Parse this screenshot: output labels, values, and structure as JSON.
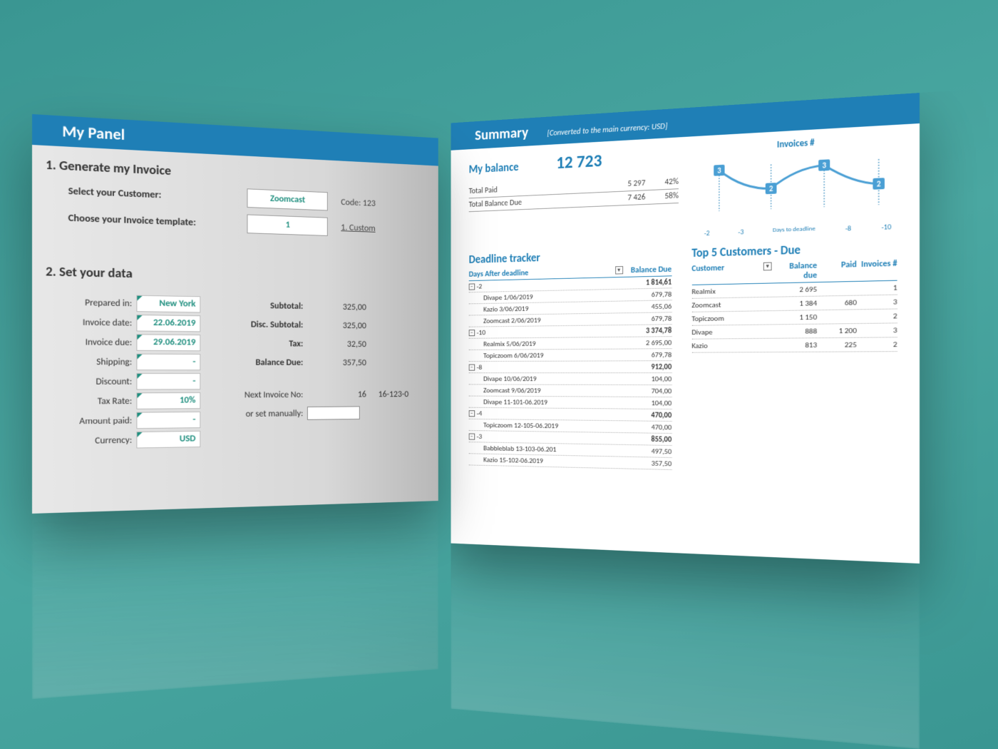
{
  "left_panel": {
    "title": "My Panel",
    "section1": {
      "title": "1. Generate my Invoice",
      "customer_label": "Select your Customer:",
      "customer_value": "Zoomcast",
      "customer_code": "Code: 123",
      "template_label": "Choose your Invoice template:",
      "template_value": "1",
      "template_name": "1. Custom"
    },
    "section2": {
      "title": "2. Set your data",
      "prepared_in_label": "Prepared in:",
      "prepared_in": "New York",
      "invoice_date_label": "Invoice date:",
      "invoice_date": "22.06.2019",
      "invoice_due_label": "Invoice due:",
      "invoice_due": "29.06.2019",
      "shipping_label": "Shipping:",
      "shipping": "-",
      "discount_label": "Discount:",
      "discount": "-",
      "tax_rate_label": "Tax Rate:",
      "tax_rate": "10%",
      "amount_paid_label": "Amount paid:",
      "amount_paid": "-",
      "currency_label": "Currency:",
      "currency": "USD",
      "subtotal_label": "Subtotal:",
      "subtotal": "325,00",
      "disc_subtotal_label": "Disc. Subtotal:",
      "disc_subtotal": "325,00",
      "tax_label": "Tax:",
      "tax": "32,50",
      "balance_due_label": "Balance Due:",
      "balance_due": "357,50",
      "next_invoice_label": "Next Invoice No:",
      "next_invoice_no": "16",
      "next_invoice_full": "16-123-0",
      "manual_label": "or set manually:"
    }
  },
  "right_panel": {
    "title": "Summary",
    "subtitle": "[Converted to the main currency: USD]",
    "balance_title": "My balance",
    "balance_value": "12 723",
    "totals": [
      {
        "label": "Total Paid",
        "amount": "5 297",
        "pct": "42%"
      },
      {
        "label": "Total Balance Due",
        "amount": "7 426",
        "pct": "58%"
      }
    ],
    "tracker_title": "Deadline tracker",
    "tracker_head_days": "Days After deadline",
    "tracker_head_bal": "Balance Due",
    "tracker_groups": [
      {
        "group": "-2",
        "total": "1 814,61",
        "rows": [
          {
            "name": "Divape 1/06/2019",
            "val": "679,78"
          },
          {
            "name": "Kazio 3/06/2019",
            "val": "455,06"
          },
          {
            "name": "Zoomcast 2/06/2019",
            "val": "679,78"
          }
        ]
      },
      {
        "group": "-10",
        "total": "3 374,78",
        "rows": [
          {
            "name": "Realmix 5/06/2019",
            "val": "2 695,00"
          },
          {
            "name": "Topiczoom 6/06/2019",
            "val": "679,78"
          }
        ]
      },
      {
        "group": "-8",
        "total": "912,00",
        "rows": [
          {
            "name": "Divape 10/06/2019",
            "val": "104,00"
          },
          {
            "name": "Zoomcast 9/06/2019",
            "val": "704,00"
          },
          {
            "name": "Divape 11-101-06.2019",
            "val": "104,00"
          }
        ]
      },
      {
        "group": "-4",
        "total": "470,00",
        "rows": [
          {
            "name": "Topiczoom 12-105-06.2019",
            "val": "470,00"
          }
        ]
      },
      {
        "group": "-3",
        "total": "855,00",
        "rows": [
          {
            "name": "Babbleblab 13-103-06.201",
            "val": "497,50"
          },
          {
            "name": "Kazio 15-102-06.2019",
            "val": "357,50"
          }
        ]
      }
    ],
    "top5_title": "Top 5 Customers - Due",
    "top5_head": {
      "c": "Customer",
      "b": "Balance due",
      "p": "Paid",
      "i": "Invoices #"
    },
    "top5": [
      {
        "c": "Realmix",
        "b": "2 695",
        "p": "",
        "i": "1"
      },
      {
        "c": "Zoomcast",
        "b": "1 384",
        "p": "680",
        "i": "3"
      },
      {
        "c": "Topiczoom",
        "b": "1 150",
        "p": "",
        "i": "2"
      },
      {
        "c": "Divape",
        "b": "888",
        "p": "1 200",
        "i": "3"
      },
      {
        "c": "Kazio",
        "b": "813",
        "p": "225",
        "i": "2"
      }
    ]
  },
  "chart_data": {
    "type": "line",
    "title": "Invoices #",
    "xlabel": "Days to deadline",
    "ylabel": "",
    "categories": [
      "-2",
      "-3",
      "-8",
      "-10"
    ],
    "values": [
      3,
      2,
      3,
      2
    ],
    "ylim": [
      0,
      3
    ]
  }
}
